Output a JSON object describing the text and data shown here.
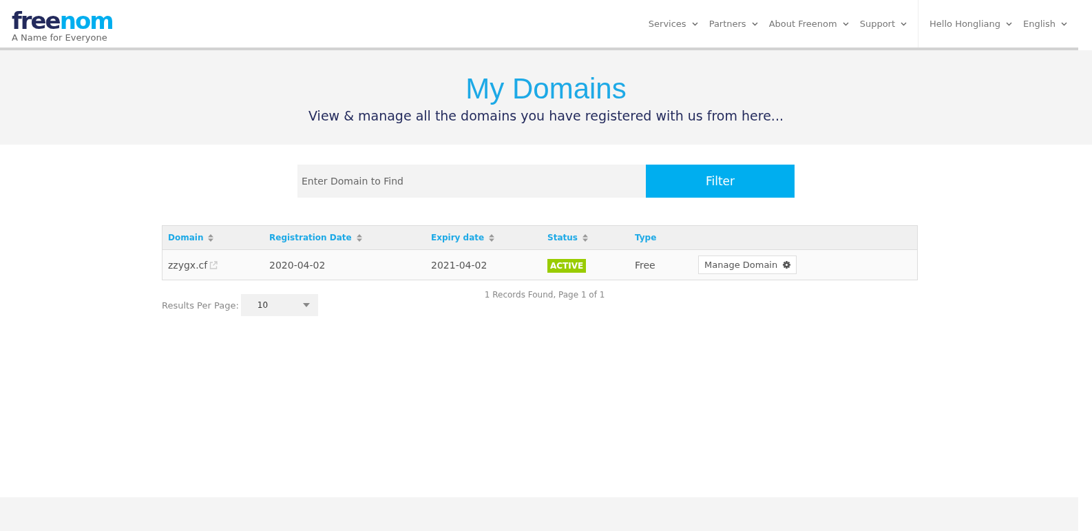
{
  "header": {
    "logo": {
      "dark": "free",
      "blue": "nom"
    },
    "tagline": "A Name for Everyone",
    "nav": [
      "Services",
      "Partners",
      "About Freenom",
      "Support"
    ],
    "user_nav": [
      "Hello Hongliang",
      "English"
    ]
  },
  "hero": {
    "title": "My Domains",
    "subtitle": "View & manage all the domains you have registered with us from here..."
  },
  "search": {
    "placeholder": "Enter Domain to Find",
    "button": "Filter"
  },
  "table": {
    "columns": [
      {
        "label": "Domain",
        "sortable": true
      },
      {
        "label": "Registration Date",
        "sortable": true
      },
      {
        "label": "Expiry date",
        "sortable": true
      },
      {
        "label": "Status",
        "sortable": true
      },
      {
        "label": "Type",
        "sortable": false
      }
    ],
    "rows": [
      {
        "domain": "zzygx.cf",
        "registration_date": "2020-04-02",
        "expiry_date": "2021-04-02",
        "status": "ACTIVE",
        "type": "Free",
        "action": "Manage Domain"
      }
    ]
  },
  "pagination": {
    "label": "Results Per Page:",
    "per_page": "10",
    "summary": "1 Records Found, Page 1 of 1"
  }
}
